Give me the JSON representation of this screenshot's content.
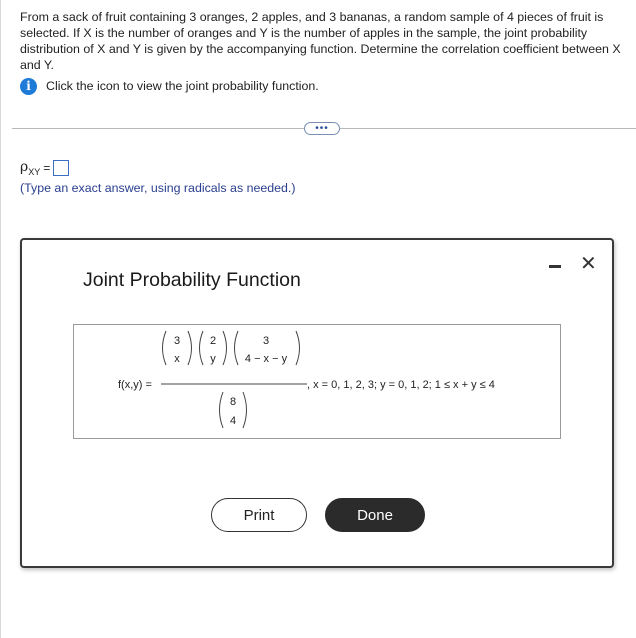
{
  "question": {
    "text": "From a sack of fruit containing 3 oranges, 2 apples, and 3 bananas, a random sample of 4 pieces of fruit is selected. If X is the number of oranges and Y is the number of apples in the sample, the joint probability distribution of X and Y is given by the accompanying function. Determine the correlation coefficient between X and Y."
  },
  "hint": {
    "icon": "info-icon",
    "text": "Click the icon to view the joint probability function."
  },
  "more_button": {
    "label": "•••"
  },
  "answer": {
    "symbol": "ρ",
    "subscript": "XY",
    "equals": "=",
    "value": ""
  },
  "instruction": "(Type an exact answer, using radicals as needed.)",
  "modal": {
    "title": "Joint Probability Function",
    "formula": {
      "lhs": "f(x,y) =",
      "num_binoms": [
        {
          "top": "3",
          "bottom": "x"
        },
        {
          "top": "2",
          "bottom": "y"
        },
        {
          "top": "3",
          "bottom": "4 − x − y"
        }
      ],
      "den_binom": {
        "top": "8",
        "bottom": "4"
      },
      "domain": ", x = 0, 1, 2, 3; y = 0, 1, 2; 1 ≤ x + y ≤ 4"
    },
    "print_label": "Print",
    "done_label": "Done",
    "minimize_icon": "minimize-icon",
    "close_icon": "close-icon",
    "close_glyph": "✕"
  }
}
